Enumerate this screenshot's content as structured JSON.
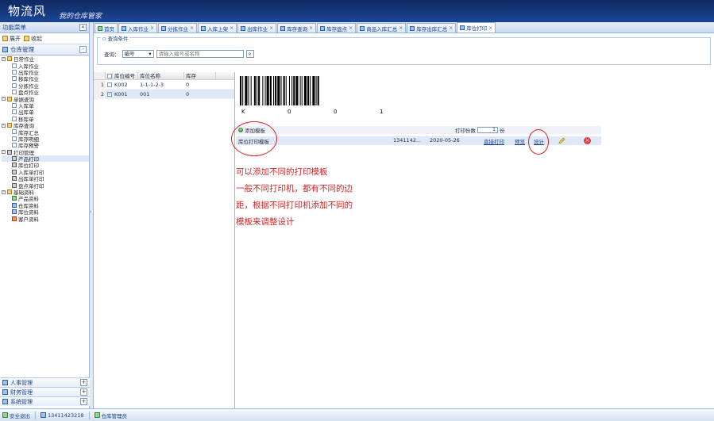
{
  "app": {
    "title": "物流风",
    "subtitle": "我的仓库管家"
  },
  "left_panel": {
    "header": "功能菜单",
    "collapse_label": "«",
    "toolbar": {
      "expand_label": "展开",
      "collapse_label": "收起"
    },
    "section": {
      "label": "仓库管理",
      "toggle": "-"
    },
    "tree": [
      {
        "level": 1,
        "label": "日常作业",
        "icon": "folder"
      },
      {
        "level": 2,
        "label": "入库作业",
        "icon": "doc"
      },
      {
        "level": 2,
        "label": "出库作业",
        "icon": "doc"
      },
      {
        "level": 2,
        "label": "移库作业",
        "icon": "doc"
      },
      {
        "level": 2,
        "label": "分拣作业",
        "icon": "doc"
      },
      {
        "level": 2,
        "label": "盘点作业",
        "icon": "doc"
      },
      {
        "level": 1,
        "label": "单据查询",
        "icon": "folder"
      },
      {
        "level": 2,
        "label": "入库单",
        "icon": "doc"
      },
      {
        "level": 2,
        "label": "出库单",
        "icon": "doc"
      },
      {
        "level": 2,
        "label": "移库单",
        "icon": "doc"
      },
      {
        "level": 1,
        "label": "库存查询",
        "icon": "folder"
      },
      {
        "level": 2,
        "label": "库存汇总",
        "icon": "doc"
      },
      {
        "level": 2,
        "label": "库存明细",
        "icon": "doc"
      },
      {
        "level": 2,
        "label": "库存预警",
        "icon": "doc"
      },
      {
        "level": 1,
        "label": "打印管理",
        "icon": "printer"
      },
      {
        "level": 2,
        "label": "产品打印",
        "icon": "printer",
        "selected": true
      },
      {
        "level": 2,
        "label": "库位打印",
        "icon": "printer"
      },
      {
        "level": 2,
        "label": "入库单打印",
        "icon": "printer"
      },
      {
        "level": 2,
        "label": "出库单打印",
        "icon": "printer"
      },
      {
        "level": 2,
        "label": "盘点单打印",
        "icon": "printer"
      },
      {
        "level": 1,
        "label": "基础资料",
        "icon": "folder"
      },
      {
        "level": 2,
        "label": "产品资料",
        "icon": "green"
      },
      {
        "level": 2,
        "label": "仓库资料",
        "icon": "blue"
      },
      {
        "level": 2,
        "label": "库位资料",
        "icon": "blue"
      },
      {
        "level": 2,
        "label": "客户资料",
        "icon": "bag"
      }
    ],
    "accordion": [
      {
        "label": "人事管理",
        "toggle": "+"
      },
      {
        "label": "财务管理",
        "toggle": "+"
      },
      {
        "label": "系统管理",
        "toggle": "+"
      }
    ]
  },
  "tabs": [
    {
      "label": "首页",
      "closable": false
    },
    {
      "label": "入库作业",
      "closable": true
    },
    {
      "label": "分拣作业",
      "closable": true
    },
    {
      "label": "入库上架",
      "closable": true
    },
    {
      "label": "出库作业",
      "closable": true
    },
    {
      "label": "库存查询",
      "closable": true
    },
    {
      "label": "库存盘点",
      "closable": true
    },
    {
      "label": "商品入库汇总",
      "closable": true
    },
    {
      "label": "库存出库汇总",
      "closable": true
    },
    {
      "label": "库位打印",
      "closable": true,
      "active": true
    }
  ],
  "query": {
    "legend": "查询条件",
    "label": "查询：",
    "mode": "编号",
    "placeholder": "请输入编号或名称"
  },
  "grid": {
    "columns": [
      "库位编号",
      "库位名称",
      "库存"
    ],
    "rows": [
      {
        "num": "1",
        "checked": false,
        "code": "K002",
        "name": "1-1-1-2-3",
        "qty": "0"
      },
      {
        "num": "2",
        "checked": true,
        "code": "K001",
        "name": "001",
        "qty": "0"
      }
    ]
  },
  "barcode": {
    "chars": [
      "K",
      "0",
      "0",
      "1"
    ]
  },
  "templates": {
    "add_label": "添加模板",
    "copies_label": "打印份数",
    "copies_value": "1",
    "copies_unit": "份",
    "row": {
      "name": "库位打印模板",
      "phone": "1341142...",
      "date": "2020-05-26",
      "print_label": "直接打印",
      "preview_label": "预览",
      "design_label": "设计"
    }
  },
  "annotation": {
    "lines": [
      "可以添加不同的打印模板",
      "一般不同打印机，都有不同的边",
      "距，根据不同打印机添加不同的",
      "模板来调整设计"
    ],
    "color": "#d12626"
  },
  "status_bar": {
    "company": "安全退出",
    "phone": "13411423218",
    "user": "仓库管理员"
  }
}
